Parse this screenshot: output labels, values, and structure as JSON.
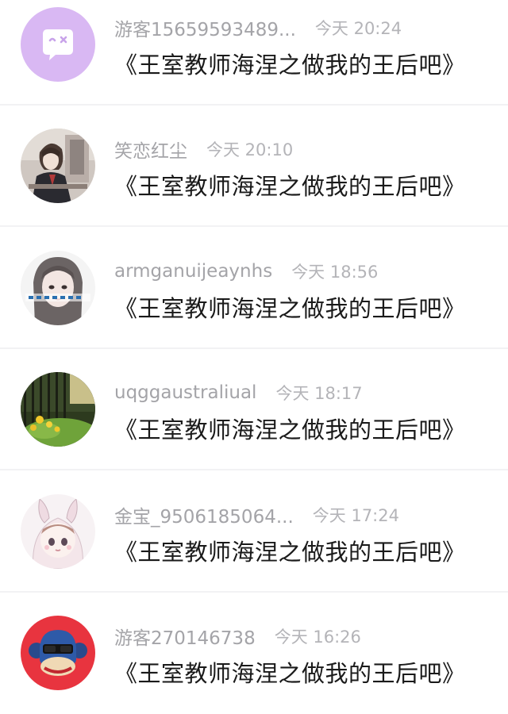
{
  "comments": [
    {
      "username": "游客15659593489...",
      "time": "今天 20:24",
      "book": "《王室教师海涅之做我的王后吧》",
      "avatar_icon": "chat-bubble-icon"
    },
    {
      "username": "笑恋红尘",
      "time": "今天 20:10",
      "book": "《王室教师海涅之做我的王后吧》",
      "avatar_icon": "anime-boy-avatar"
    },
    {
      "username": "armganuijeaynhs",
      "time": "今天 18:56",
      "book": "《王室教师海涅之做我的王后吧》",
      "avatar_icon": "girl-photo-avatar"
    },
    {
      "username": "uqggaustraliual",
      "time": "今天 18:17",
      "book": "《王室教师海涅之做我的王后吧》",
      "avatar_icon": "flower-photo-avatar"
    },
    {
      "username": "金宝_9506185064...",
      "time": "今天 17:24",
      "book": "《王室教师海涅之做我的王后吧》",
      "avatar_icon": "anime-girl-bunny-hood-avatar"
    },
    {
      "username": "游客270146738",
      "time": "今天 16:26",
      "book": "《王室教师海涅之做我的王后吧》",
      "avatar_icon": "monkey-face-icon"
    }
  ],
  "colors": {
    "guest_avatar_bg": "#d9b8f3",
    "monkey_avatar_bg": "#e8343f",
    "username": "#a4a4a8",
    "time": "#b4b4b8",
    "book_title": "#1a1a1a",
    "divider": "#f2f2f4"
  }
}
